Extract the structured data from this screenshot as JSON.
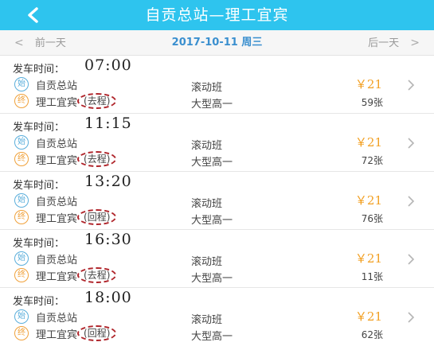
{
  "header": {
    "title": "自贡总站—理工宜宾"
  },
  "datebar": {
    "prev_arrow": "<",
    "prev_label": "前一天",
    "current_date": "2017-10-11 周三",
    "next_label": "后一天",
    "next_arrow": ">"
  },
  "trips": [
    {
      "time_label": "发车时间：",
      "time": "07:00",
      "start_badge": "始",
      "start_stop": "自贡总站",
      "end_badge": "终",
      "end_stop": "理工宜宾",
      "direction": "(去程)",
      "bus_type": "滚动班",
      "bus_model": "大型高一",
      "price": "￥21",
      "seats": "59张"
    },
    {
      "time_label": "发车时间：",
      "time": "11:15",
      "start_badge": "始",
      "start_stop": "自贡总站",
      "end_badge": "终",
      "end_stop": "理工宜宾",
      "direction": "(去程)",
      "bus_type": "滚动班",
      "bus_model": "大型高一",
      "price": "￥21",
      "seats": "72张"
    },
    {
      "time_label": "发车时间：",
      "time": "13:20",
      "start_badge": "始",
      "start_stop": "自贡总站",
      "end_badge": "终",
      "end_stop": "理工宜宾",
      "direction": "(回程)",
      "bus_type": "滚动班",
      "bus_model": "大型高一",
      "price": "￥21",
      "seats": "76张"
    },
    {
      "time_label": "发车时间：",
      "time": "16:30",
      "start_badge": "始",
      "start_stop": "自贡总站",
      "end_badge": "终",
      "end_stop": "理工宜宾",
      "direction": "(去程)",
      "bus_type": "滚动班",
      "bus_model": "大型高一",
      "price": "￥21",
      "seats": "11张"
    },
    {
      "time_label": "发车时间：",
      "time": "18:00",
      "start_badge": "始",
      "start_stop": "自贡总站",
      "end_badge": "终",
      "end_stop": "理工宜宾",
      "direction": "(回程)",
      "bus_type": "滚动班",
      "bus_model": "大型高一",
      "price": "￥21",
      "seats": "62张"
    }
  ],
  "colors": {
    "header_bg": "#2ec4ee",
    "price": "#f2a023",
    "start_badge": "#5aaedb",
    "end_badge": "#f0a13a",
    "annotation_circle": "#b0262c",
    "date_accent": "#3a8fcf"
  },
  "icons": {
    "back": "chevron-left-icon",
    "row": "chevron-right-icon"
  }
}
